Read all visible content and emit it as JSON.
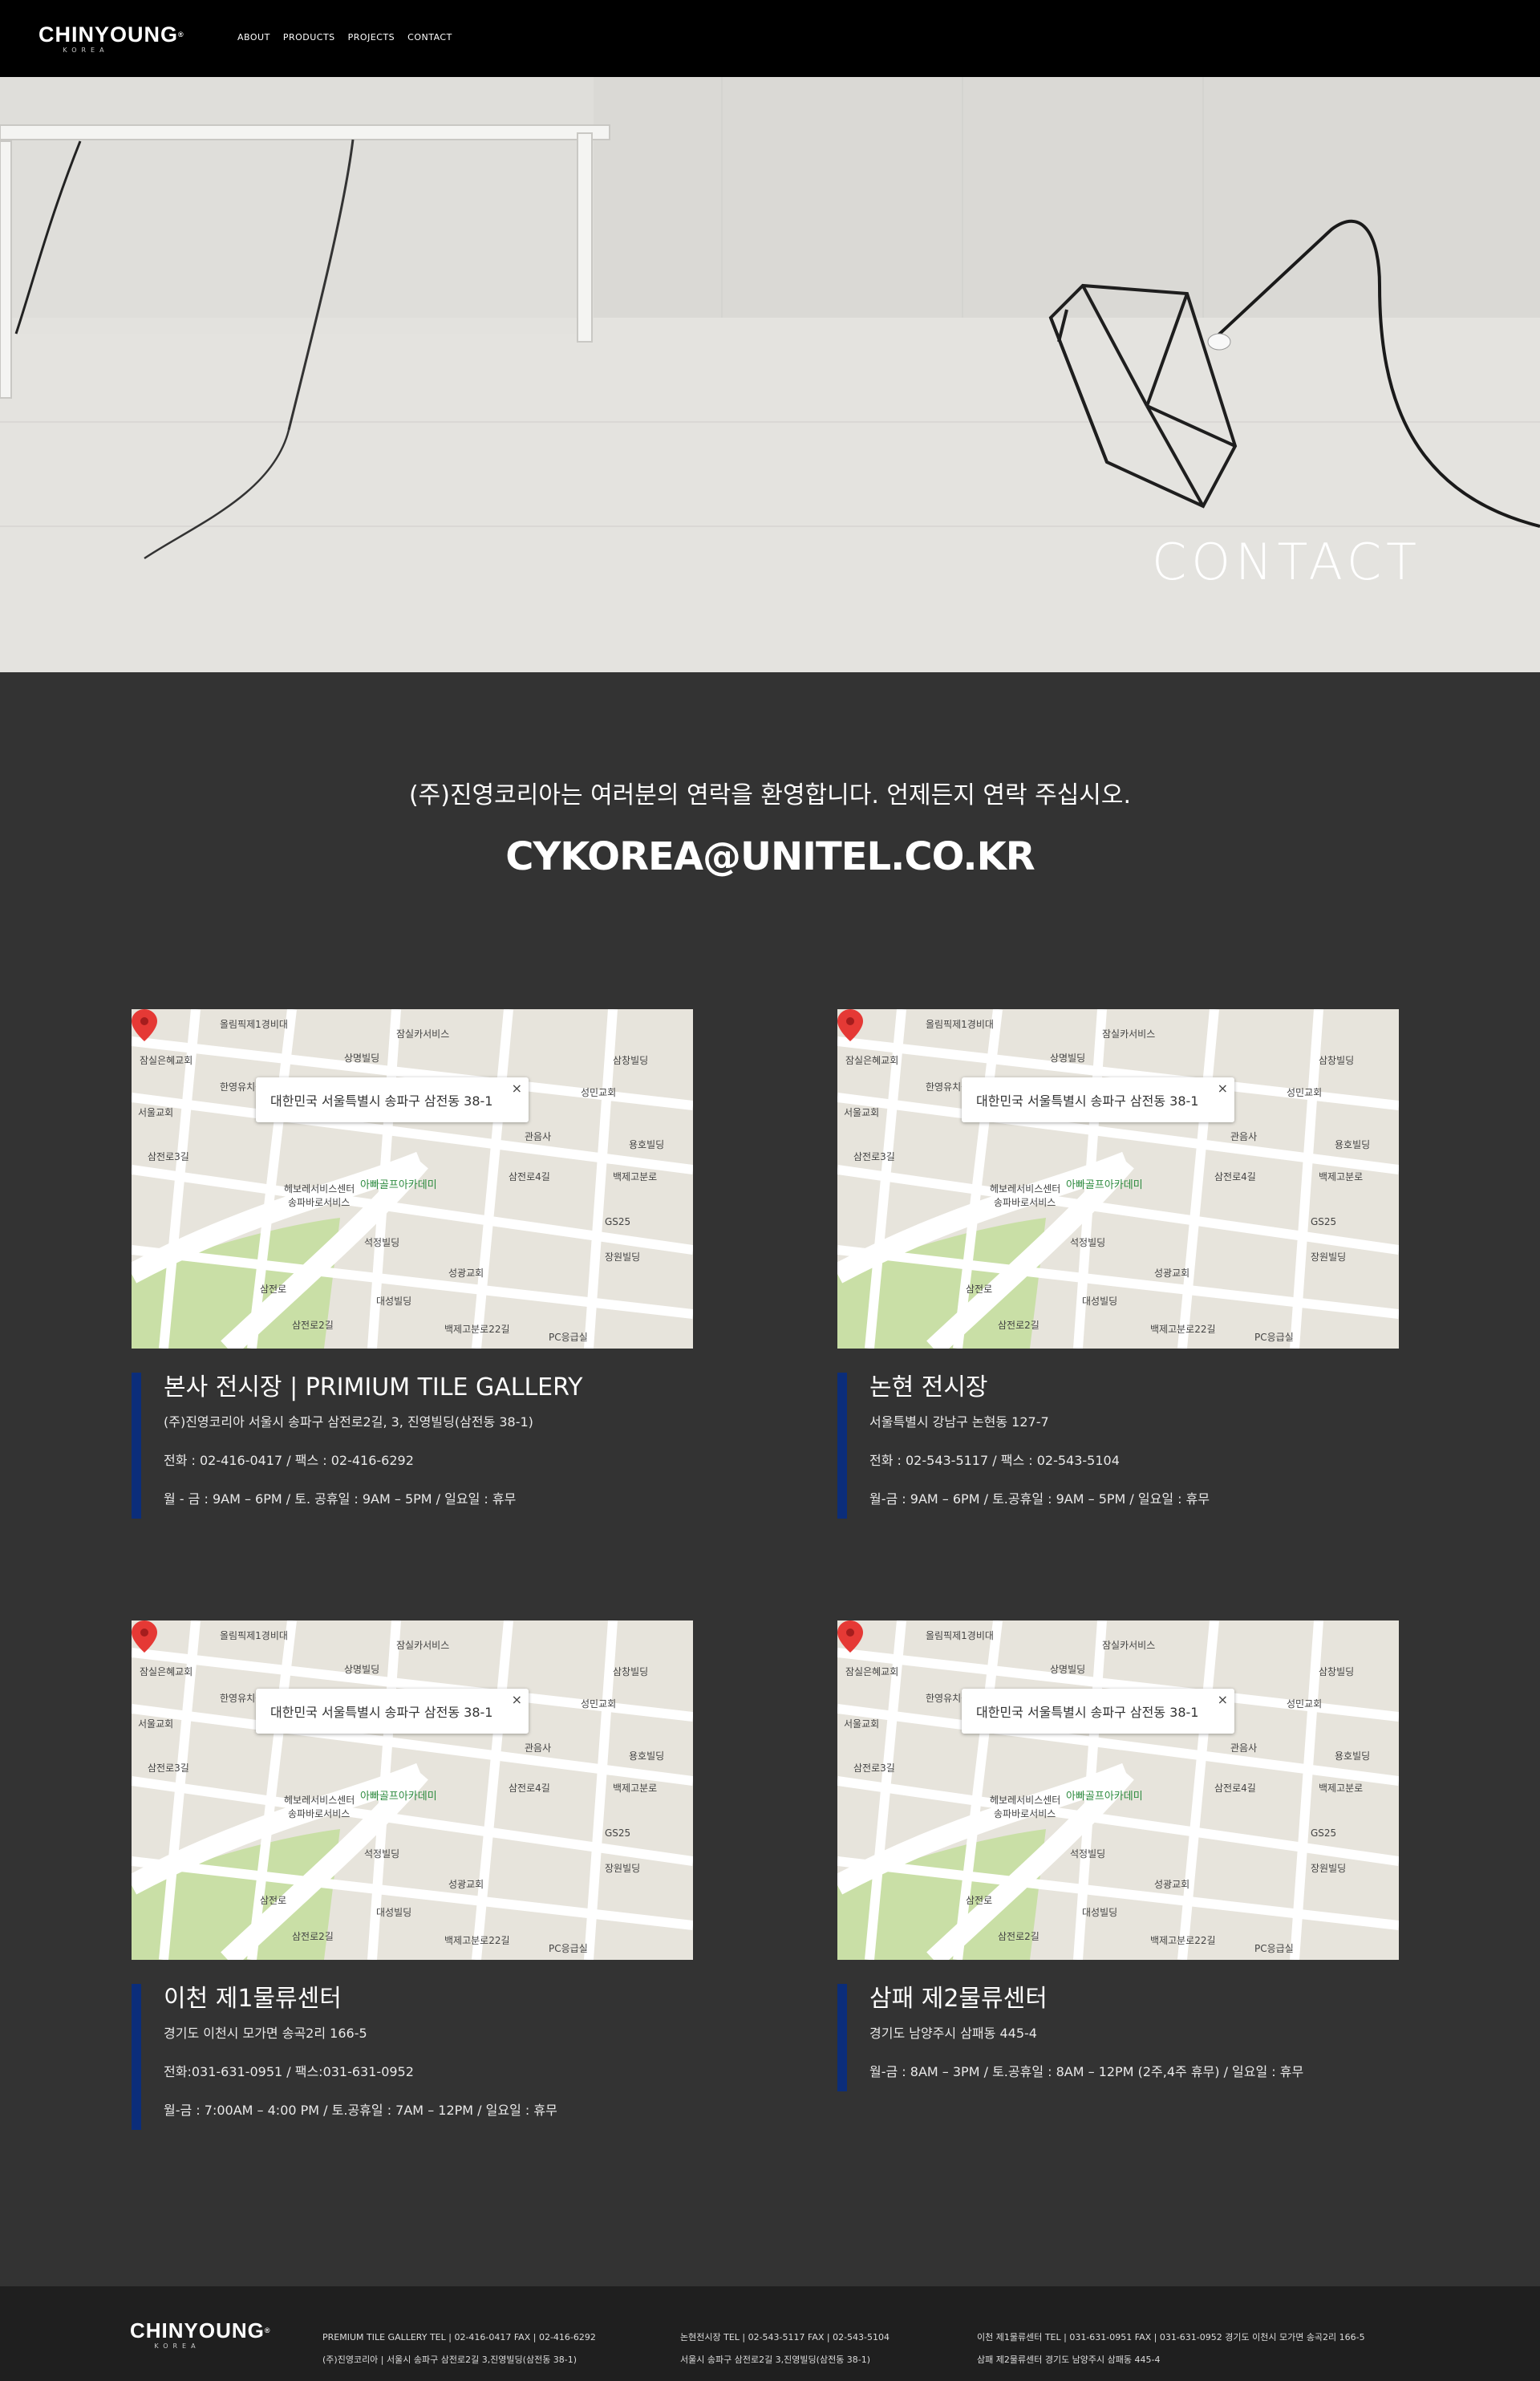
{
  "header": {
    "logo_main": "CHINYOUNG",
    "logo_tm": "®",
    "logo_sub": "KOREA",
    "nav": [
      "ABOUT",
      "PRODUCTS",
      "PROJECTS",
      "CONTACT"
    ]
  },
  "hero": {
    "title": "CONTACT"
  },
  "intro": {
    "message": "(주)진영코리아는 여러분의 연락을 환영합니다. 언제든지 연락 주십시오.",
    "email": "CYKOREA@UNITEL.CO.KR"
  },
  "map": {
    "popup_text": "대한민국 서울특별시 송파구 삼전동 38-1",
    "close": "×",
    "place": "아빠골프아카데미",
    "labels": [
      "올림픽제1경비대",
      "잠실카서비스",
      "상명빌딩",
      "삼창빌딩",
      "잠실은혜교회",
      "성민교회",
      "한영유치원",
      "서울교회",
      "관음사",
      "용호빌딩",
      "삼전로3길",
      "삼전로4길",
      "백제고분로",
      "헤보레서비스센터",
      "송파바로서비스",
      "GS25",
      "석정빌딩",
      "장원빌딩",
      "성광교회",
      "대성빌딩",
      "삼전로",
      "삼전로2길",
      "백제고분로22길",
      "PC응급실"
    ]
  },
  "locations": [
    {
      "title": "본사 전시장 | PRIMIUM TILE GALLERY",
      "lines": [
        "(주)진영코리아 서울시 송파구 삼전로2길, 3, 진영빌딩(삼전동 38-1)",
        "전화 : 02-416-0417 / 팩스 : 02-416-6292",
        "월 - 금 : 9AM – 6PM / 토. 공휴일 : 9AM – 5PM / 일요일 : 휴무"
      ]
    },
    {
      "title": "논현 전시장",
      "lines": [
        "서울특별시 강남구 논현동 127-7",
        "전화 : 02-543-5117 / 팩스 : 02-543-5104",
        "월-금 : 9AM – 6PM / 토.공휴일 : 9AM – 5PM / 일요일 : 휴무"
      ]
    },
    {
      "title": "이천 제1물류센터",
      "lines": [
        "경기도 이천시 모가면 송곡2리 166-5",
        "전화:031-631-0951 / 팩스:031-631-0952",
        "월-금 : 7:00AM – 4:00 PM / 토.공휴일 : 7AM – 12PM / 일요일 : 휴무"
      ]
    },
    {
      "title": "삼패 제2물류센터",
      "lines": [
        "경기도 남양주시 삼패동 445-4",
        "월-금 : 8AM – 3PM / 토.공휴일 : 8AM – 12PM (2주,4주 휴무) / 일요일 : 휴무"
      ]
    }
  ],
  "footer": {
    "logo_main": "CHINYOUNG",
    "logo_tm": "®",
    "logo_sub": "KOREA",
    "col1": [
      "PREMIUM TILE GALLERY     TEL | 02-416-0417     FAX | 02-416-6292",
      "(주)진영코리아 | 서울시 송파구 삼전로2길 3,진영빌딩(삼전동 38-1)"
    ],
    "col2": [
      "논현전시장     TEL | 02-543-5117     FAX | 02-543-5104",
      "서울시 송파구 삼전로2길 3,진영빌딩(삼전동 38-1)"
    ],
    "col3": [
      "이천 제1물류센터     TEL | 031-631-0951     FAX | 031-631-0952     경기도 이천시 모가면 송곡2리 166-5",
      "삼패 제2물류센터     경기도 남양주시 삼패동 445-4"
    ]
  },
  "colors": {
    "accent_bar": "#0b2d7a",
    "background": "#333333",
    "header": "#000000",
    "footer": "#1f1f1f"
  }
}
